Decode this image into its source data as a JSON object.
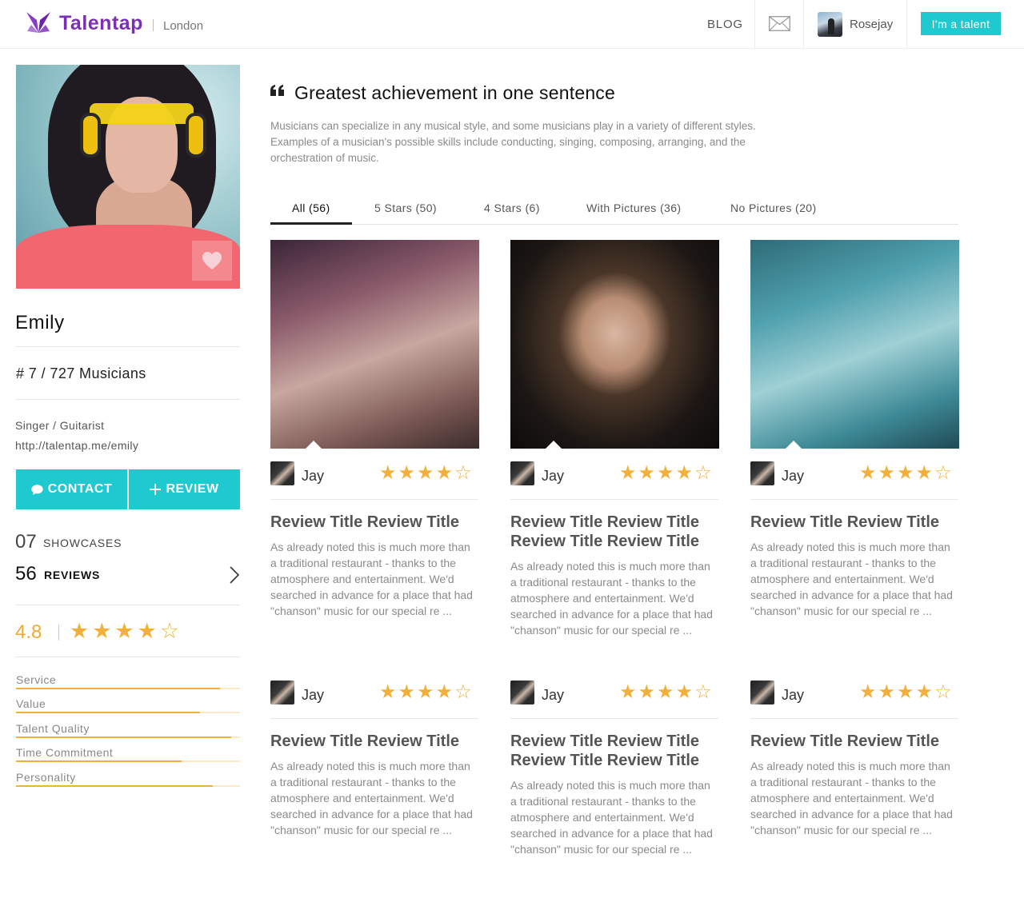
{
  "header": {
    "brand": "Talentap",
    "city": "London",
    "nav_blog": "BLOG",
    "user_name": "Rosejay",
    "cta": "I'm a talent"
  },
  "profile": {
    "name": "Emily",
    "rank": "# 7 / 727 Musicians",
    "role": "Singer / Guitarist",
    "url": "http://talentap.me/emily",
    "contact_label": "CONTACT",
    "review_label": "REVIEW",
    "showcases_count": "07",
    "showcases_label": "SHOWCASES",
    "reviews_count": "56",
    "reviews_label": "REVIEWS",
    "rating": "4.8",
    "rating_stars": "★★★★☆",
    "metrics": [
      {
        "label": "Service",
        "value": 0.91
      },
      {
        "label": "Value",
        "value": 0.82
      },
      {
        "label": "Talent Quality",
        "value": 0.96
      },
      {
        "label": "Time Commitment",
        "value": 0.74
      },
      {
        "label": "Personality",
        "value": 0.88
      }
    ]
  },
  "main": {
    "headline": "Greatest achievement in one sentence",
    "intro": "Musicians can specialize in any musical style, and some musicians play in a variety of different styles. Examples of a musician's possible skills include conducting, singing, composing, arranging, and the orchestration of music.",
    "tabs": [
      {
        "label": "All (56)"
      },
      {
        "label": "5 Stars (50)"
      },
      {
        "label": "4 Stars (6)"
      },
      {
        "label": "With Pictures (36)"
      },
      {
        "label": "No Pictures (20)"
      }
    ],
    "reviews": [
      {
        "reviewer": "Jay",
        "stars": "★★★★☆",
        "title": "Review Title Review Title",
        "body": "As already noted this is much more than a traditional restaurant - thanks to the atmosphere and entertainment. We'd searched in advance for a place that had \"chanson\" music for our special re ..."
      },
      {
        "reviewer": "Jay",
        "stars": "★★★★☆",
        "title": "Review Title Review Title Review Title Review Title",
        "body": "As already noted this is much more than a traditional restaurant - thanks to the atmosphere and entertainment. We'd searched in advance for a place that had \"chanson\" music for our special re ..."
      },
      {
        "reviewer": "Jay",
        "stars": "★★★★☆",
        "title": "Review Title Review Title",
        "body": "As already noted this is much more than a traditional restaurant - thanks to the atmosphere and entertainment. We'd searched in advance for a place that had \"chanson\" music for our special re ..."
      },
      {
        "reviewer": "Jay",
        "stars": "★★★★☆",
        "title": "Review Title Review Title",
        "body": "As already noted this is much more than a traditional restaurant - thanks to the atmosphere and entertainment. We'd searched in advance for a place that had \"chanson\" music for our special re ..."
      },
      {
        "reviewer": "Jay",
        "stars": "★★★★☆",
        "title": "Review Title Review Title Review Title Review Title",
        "body": "As already noted this is much more than a traditional restaurant - thanks to the atmosphere and entertainment. We'd searched in advance for a place that had \"chanson\" music for our special re ..."
      },
      {
        "reviewer": "Jay",
        "stars": "★★★★☆",
        "title": "Review Title Review Title",
        "body": "As already noted this is much more than a traditional restaurant - thanks to the atmosphere and entertainment. We'd searched in advance for a place that had \"chanson\" music for our special re ..."
      }
    ]
  },
  "colors": {
    "accent": "#1ec9cf",
    "brand": "#7a2fb4",
    "star": "#f2b03a"
  },
  "icons": [
    "butterfly-logo-icon",
    "mail-icon",
    "heart-icon",
    "chat-bubble-icon",
    "plus-icon",
    "chevron-right-icon",
    "quote-icon",
    "star-icon"
  ]
}
